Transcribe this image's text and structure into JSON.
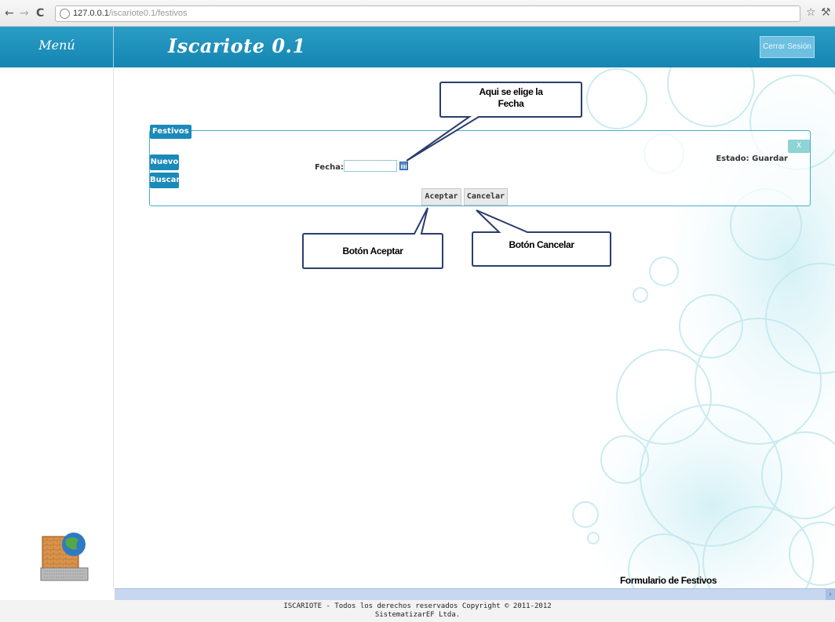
{
  "browser": {
    "url_host": "127.0.0.1",
    "url_path": "/iscariote0.1/festivos"
  },
  "header": {
    "menu_title": "Menú",
    "app_title": "Iscariote 0.1",
    "logout_label": "Cerrar Sesión"
  },
  "form": {
    "legend": "Festivos",
    "nuevo_label": "Nuevo",
    "buscar_label": "Buscar",
    "fecha_label": "Fecha:",
    "fecha_value": "",
    "estado": "Estado: Guardar",
    "close_label": "X",
    "aceptar_label": "Aceptar",
    "cancelar_label": "Cancelar"
  },
  "callouts": {
    "fecha_line1": "Aqui se elige la",
    "fecha_line2": "Fecha",
    "aceptar": "Botón Aceptar",
    "cancelar": "Botón Cancelar"
  },
  "caption": "Formulario de Festivos",
  "footer": {
    "line1": "ISCARIOTE - Todos los derechos reservados Copyright © 2011-2012",
    "line2": "SistematizarEF Ltda."
  },
  "colors": {
    "header": "#1a8ab8",
    "panel_border": "#4aaccc",
    "callout_border": "#2a3d6e"
  }
}
